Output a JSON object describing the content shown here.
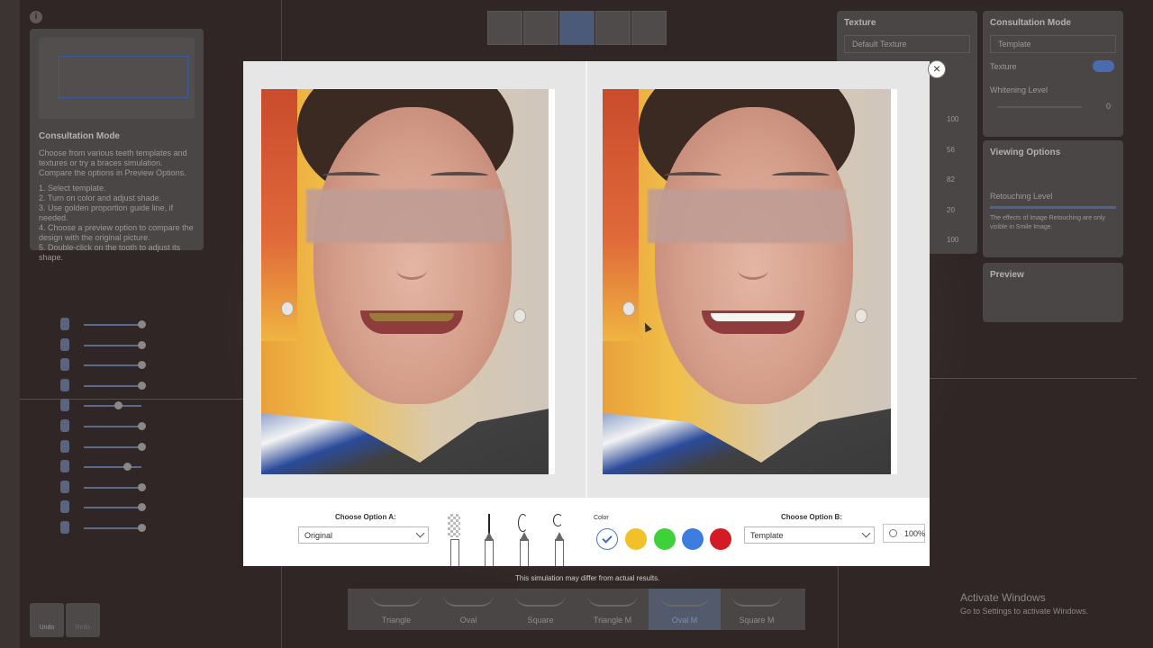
{
  "background": {
    "info_icon": "info-icon",
    "consultation_panel": {
      "title": "Consultation Mode",
      "description": "Choose from various teeth templates and textures or try a braces simulation. Compare the options in Preview Options.",
      "steps": [
        "1. Select template.",
        "2. Turn on color and adjust shade.",
        "3. Use golden proportion guide line, if needed.",
        "4. Choose a preview option to compare the design with the original picture.",
        "5. Double-click on the tooth to adjust its shape."
      ]
    },
    "texture_panel": {
      "title": "Texture",
      "select_value": "Default Texture",
      "values": [
        "100",
        "56",
        "82",
        "20",
        "100"
      ]
    },
    "consultation_mode_panel": {
      "title": "Consultation Mode",
      "template_select": "Template",
      "texture_label": "Texture",
      "whitening_label": "Whitening Level",
      "whitening_value": "0"
    },
    "viewing_options": {
      "title": "Viewing Options",
      "retouching_label": "Retouching Level",
      "note": "The effects of Image Retouching are only visible in Smile Image."
    },
    "preview_panel": {
      "title": "Preview"
    },
    "undo_label": "Undo",
    "redo_label": "Redo",
    "templates": [
      "Triangle",
      "Oval",
      "Square",
      "Triangle M",
      "Oval M",
      "Square M"
    ],
    "active_template": "Oval M",
    "disclaimer": "This simulation may differ from actual results.",
    "watermark": {
      "title": "Activate Windows",
      "subtitle": "Go to Settings to activate Windows."
    }
  },
  "modal": {
    "close_icon": "close-icon",
    "option_a_label": "Choose Option A:",
    "option_a_value": "Original",
    "option_b_label": "Choose Option B:",
    "option_b_value": "Template",
    "color_label": "Color",
    "colors": [
      "#ffffff",
      "#f2c029",
      "#3fd13a",
      "#3d7de0",
      "#d41a24"
    ],
    "zoom": "100%",
    "tools": [
      "eraser-tool-icon",
      "pen-thin-icon",
      "pen-curve-icon",
      "pen-scribble-icon"
    ]
  }
}
